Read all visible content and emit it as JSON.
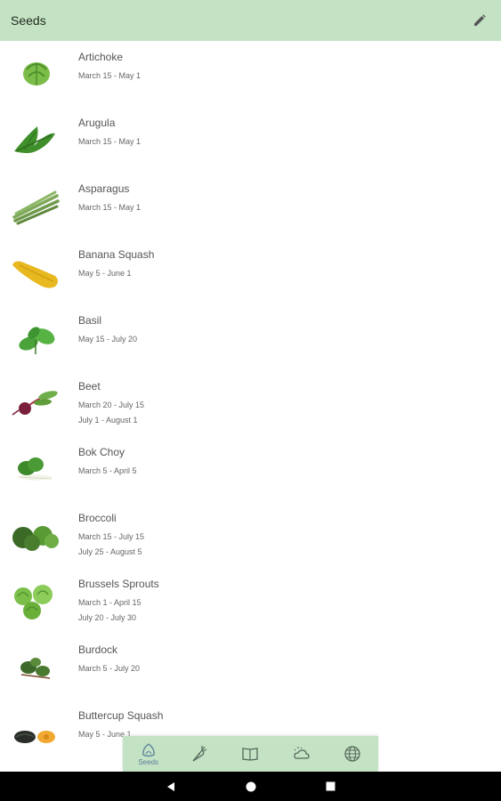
{
  "appbar": {
    "title": "Seeds",
    "edit_icon": "pencil-icon"
  },
  "seeds": [
    {
      "name": "Artichoke",
      "dates": [
        "March 15 - May 1"
      ]
    },
    {
      "name": "Arugula",
      "dates": [
        "March 15 - May 1"
      ]
    },
    {
      "name": "Asparagus",
      "dates": [
        "March 15 - May 1"
      ]
    },
    {
      "name": "Banana Squash",
      "dates": [
        "May 5 - June 1"
      ]
    },
    {
      "name": "Basil",
      "dates": [
        "May 15 - July 20"
      ]
    },
    {
      "name": "Beet",
      "dates": [
        "March 20 - July 15",
        "July 1 - August 1"
      ]
    },
    {
      "name": "Bok Choy",
      "dates": [
        "March 5 - April 5"
      ]
    },
    {
      "name": "Broccoli",
      "dates": [
        "March 15 - July 15",
        "July 25 - August 5"
      ]
    },
    {
      "name": "Brussels Sprouts",
      "dates": [
        "March 1 - April 15",
        "July 20 - July 30"
      ]
    },
    {
      "name": "Burdock",
      "dates": [
        "March 5 - July 20"
      ]
    },
    {
      "name": "Buttercup Squash",
      "dates": [
        "May 5 - June 1"
      ]
    }
  ],
  "bottom_nav": {
    "items": [
      {
        "icon": "seed-icon",
        "label": "Seeds"
      },
      {
        "icon": "carrot-icon"
      },
      {
        "icon": "book-icon"
      },
      {
        "icon": "weather-icon"
      },
      {
        "icon": "globe-icon"
      }
    ],
    "active_color": "#5b7f9b"
  },
  "system_nav": {
    "back": "back-icon",
    "home": "home-icon",
    "recents": "recents-icon"
  }
}
